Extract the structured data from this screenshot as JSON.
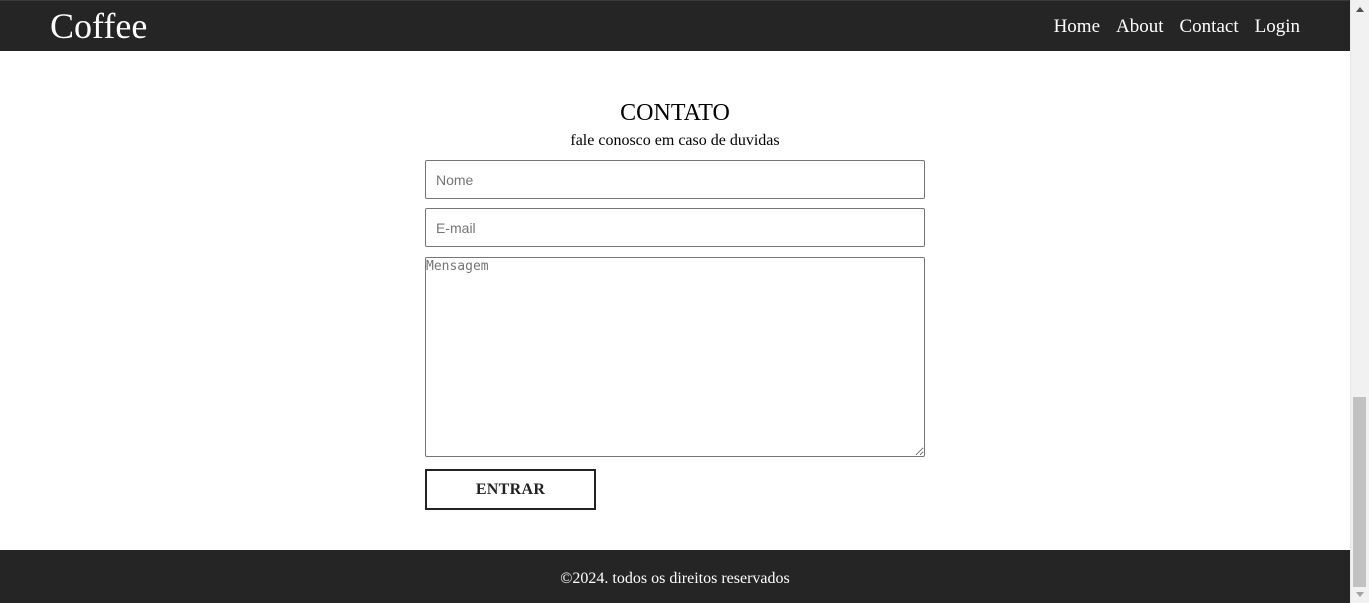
{
  "header": {
    "brand": "Coffee",
    "nav": [
      {
        "label": "Home"
      },
      {
        "label": "About"
      },
      {
        "label": "Contact"
      },
      {
        "label": "Login"
      }
    ]
  },
  "contact": {
    "title": "CONTATO",
    "subtitle": "fale conosco em caso de duvidas",
    "name_placeholder": "Nome",
    "email_placeholder": "E-mail",
    "message_placeholder": "Mensagem",
    "submit_label": "ENTRAR"
  },
  "footer": {
    "text": "©2024. todos os direitos reservados"
  },
  "colors": {
    "header_bg": "#252525",
    "footer_bg": "#252525",
    "page_bg": "#ffffff"
  }
}
